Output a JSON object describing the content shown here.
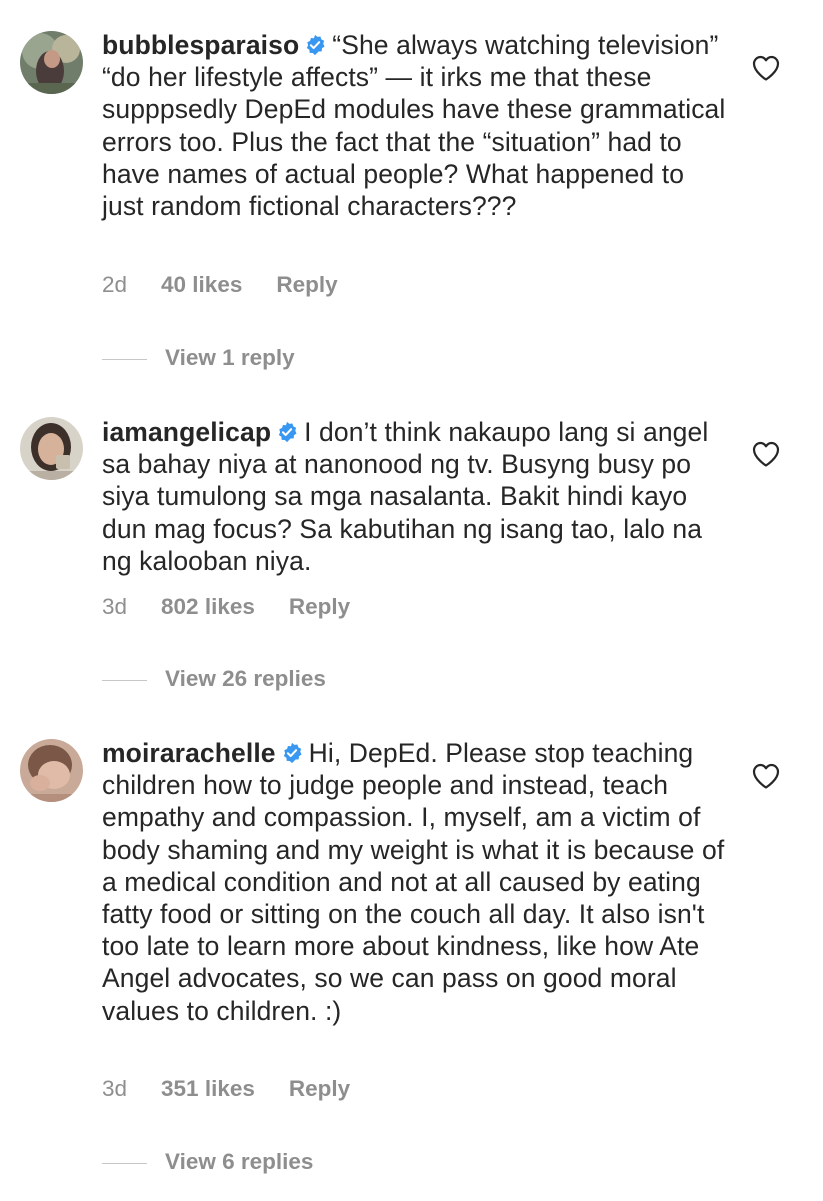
{
  "comments": [
    {
      "username": "bubblesparaiso",
      "text": "“She always watching television” “do her lifestyle affects” — it irks me that these supppsedly DepEd modules have these grammatical errors too. Plus the fact that the “situation” had to have names of actual people? What happened to just random fictional characters???",
      "time": "2d",
      "likes": "40 likes",
      "reply_label": "Reply",
      "view_replies": "View 1 reply",
      "avatar_icon": "avatar-photo",
      "verified_icon": "verified-badge-icon"
    },
    {
      "username": "iamangelicap",
      "text": "I don’t think nakaupo lang si angel sa bahay niya at nanonood ng tv. Busyng busy po siya tumulong sa mga nasalanta. Bakit hindi kayo dun mag focus? Sa kabutihan ng isang tao, lalo na ng kalooban niya.",
      "time": "3d",
      "likes": "802 likes",
      "reply_label": "Reply",
      "view_replies": "View 26 replies",
      "avatar_icon": "avatar-photo",
      "verified_icon": "verified-badge-icon"
    },
    {
      "username": "moirarachelle",
      "text": "Hi, DepEd. Please stop teaching children how to judge people and instead, teach empathy and compassion. I, myself, am a victim of body shaming and my weight is what it is because of a medical condition and not at all caused by eating fatty food or sitting on the couch all day. It also isn't too late to learn more about kindness, like how Ate Angel advocates, so we can pass on good moral values to children. :)",
      "time": "3d",
      "likes": "351 likes",
      "reply_label": "Reply",
      "view_replies": "View 6 replies",
      "avatar_icon": "avatar-photo",
      "verified_icon": "verified-badge-icon"
    }
  ],
  "colors": {
    "text": "#262626",
    "secondary": "#8e8e8e",
    "verified": "#3897f0",
    "divider": "#c7c7c7"
  },
  "icons": {
    "like": "heart-outline-icon"
  }
}
